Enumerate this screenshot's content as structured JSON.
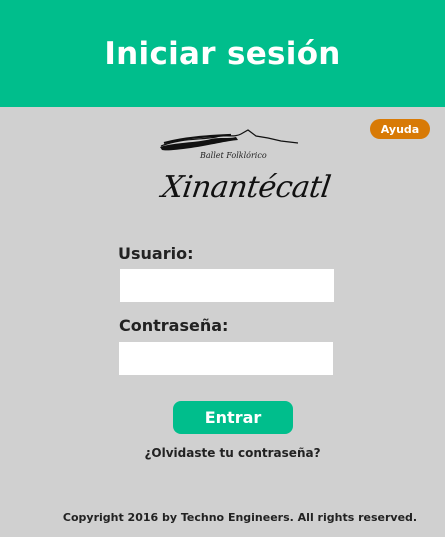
{
  "header": {
    "title": "Iniciar sesión"
  },
  "help": {
    "label": "Ayuda"
  },
  "logo": {
    "subtitle": "Ballet Folklórico",
    "name": "Xinantécatl"
  },
  "form": {
    "username_label": "Usuario:",
    "username_value": "",
    "password_label": "Contraseña:",
    "password_value": "",
    "submit_label": "Entrar",
    "forgot_label": "¿Olvidaste tu contraseña?"
  },
  "footer": {
    "copyright": "Copyright 2016 by Techno Engineers. All rights reserved."
  },
  "colors": {
    "brand": "#00be8c",
    "help": "#d87a06",
    "background": "#d0d0d0"
  }
}
